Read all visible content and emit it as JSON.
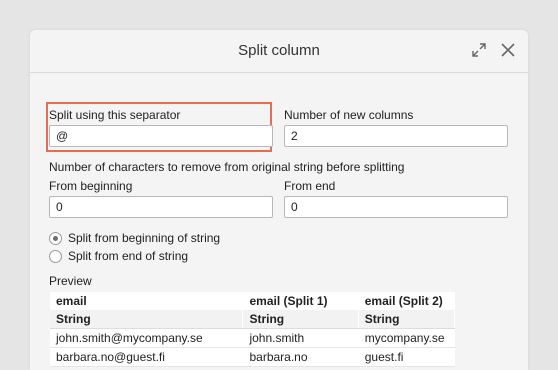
{
  "dialog": {
    "title": "Split column",
    "separator_label": "Split using this separator",
    "separator_value": "@",
    "new_columns_label": "Number of new columns",
    "new_columns_value": "2",
    "remove_chars_label": "Number of characters to remove from original string before splitting",
    "from_beginning_label": "From beginning",
    "from_beginning_value": "0",
    "from_end_label": "From end",
    "from_end_value": "0",
    "radio_beginning": "Split from beginning of string",
    "radio_end": "Split from end of string",
    "preview_label": "Preview"
  },
  "preview": {
    "headers": [
      "email",
      "email (Split 1)",
      "email (Split 2)"
    ],
    "types": [
      "String",
      "String",
      "String"
    ],
    "rows": [
      [
        "john.smith@mycompany.se",
        "john.smith",
        "mycompany.se"
      ],
      [
        "barbara.no@guest.fi",
        "barbara.no",
        "guest.fi"
      ]
    ]
  },
  "colors": {
    "highlight": "#e66d4f"
  },
  "icons": [
    "expand-icon",
    "close-icon"
  ]
}
